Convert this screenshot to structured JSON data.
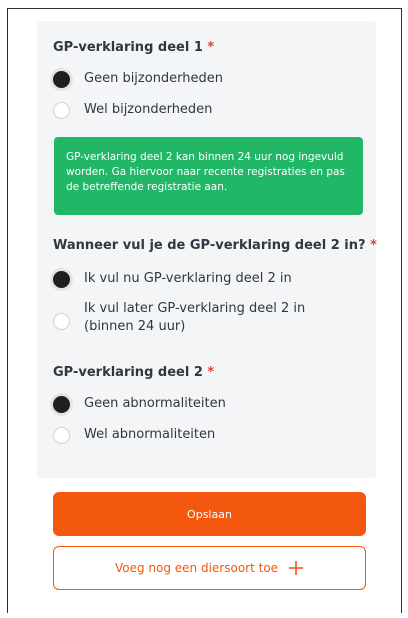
{
  "sections": {
    "gp1": {
      "title": "GP-verklaring deel 1",
      "required_mark": "*",
      "options": [
        {
          "label": "Geen bijzonderheden",
          "checked": true
        },
        {
          "label": "Wel bijzonderheden",
          "checked": false
        }
      ]
    },
    "info": {
      "text": "GP-verklaring deel 2 kan binnen 24 uur nog ingevuld worden. Ga hiervoor naar recente registraties en pas de betreffende registratie aan."
    },
    "when": {
      "title": "Wanneer vul je de GP-verklaring deel 2 in?",
      "required_mark": "*",
      "options": [
        {
          "label": "Ik vul nu GP-verklaring deel 2 in",
          "checked": true
        },
        {
          "label": "Ik vul later GP-verklaring deel 2 in (binnen 24 uur)",
          "checked": false
        }
      ]
    },
    "gp2": {
      "title": "GP-verklaring deel 2",
      "required_mark": "*",
      "options": [
        {
          "label": "Geen abnormaliteiten",
          "checked": true
        },
        {
          "label": "Wel abnormaliteiten",
          "checked": false
        }
      ]
    }
  },
  "buttons": {
    "save": "Opslaan",
    "add_species": "Voeg nog een diersoort toe"
  },
  "colors": {
    "accent": "#f4580f",
    "success": "#21b767",
    "required": "#e2432b"
  },
  "icons": {
    "add": "plus-icon"
  }
}
